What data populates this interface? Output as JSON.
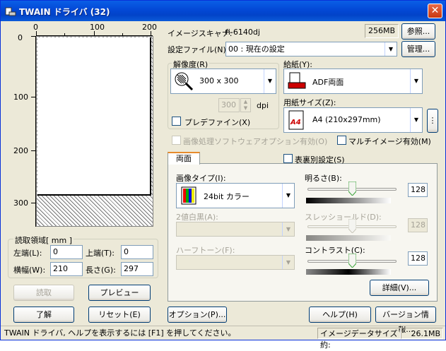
{
  "window": {
    "title": "TWAIN ドライバ (32)",
    "close": "✕"
  },
  "ruler": {
    "top_labels": [
      "0",
      "100",
      "200"
    ],
    "left_labels": [
      "0",
      "100",
      "200",
      "300"
    ]
  },
  "scanner": {
    "label": "イメージスキャナ:",
    "model": "fi-6140dj",
    "memory": "256MB",
    "browse": "参照..."
  },
  "settings_file": {
    "label": "設定ファイル(N):",
    "value": "00 : 現在の設定",
    "manage": "管理..."
  },
  "resolution": {
    "label": "解像度(R)",
    "value": "300 x 300",
    "custom_value": "300",
    "unit": "dpi",
    "prefine": "プレデファイン(X)"
  },
  "paper_source": {
    "label": "給紙(Y):",
    "value": "ADF両面"
  },
  "paper_size": {
    "label": "用紙サイズ(Z):",
    "value": "A4 (210x297mm)",
    "more": "⋮"
  },
  "image_option": "画像処理ソフトウェアオプション有効(O)",
  "multi_image": "マルチイメージ有効(M)",
  "tabs": {
    "active": "両面",
    "front_back": "表裏別設定(S)"
  },
  "image_type": {
    "label": "画像タイプ(I):",
    "value": "24bit カラー"
  },
  "binary": {
    "label": "2値白黒(A):",
    "value": ""
  },
  "halftone": {
    "label": "ハーフトーン(F):",
    "value": ""
  },
  "brightness": {
    "label": "明るさ(B):",
    "value": "128"
  },
  "threshold": {
    "label": "スレッショールド(D):",
    "value": "128"
  },
  "contrast": {
    "label": "コントラスト(C):",
    "value": "128"
  },
  "detail": "詳細(V)...",
  "scan_area": {
    "title": "読取領域[ mm ]",
    "left_label": "左端(L):",
    "left_value": "0",
    "top_label": "上端(T):",
    "top_value": "0",
    "width_label": "横幅(W):",
    "width_value": "210",
    "length_label": "長さ(G):",
    "length_value": "297"
  },
  "buttons": {
    "scan": "読取",
    "preview": "プレビュー",
    "ok": "了解",
    "reset": "リセット(E)",
    "options": "オプション(P)...",
    "help": "ヘルプ(H)",
    "version": "バージョン情報..."
  },
  "status": {
    "message": "TWAIN ドライバ, ヘルプを表示するには [F1] を押してください。",
    "size_label": "イメージデータサイズ 約:",
    "size_value": "26.1MB"
  },
  "colors": {
    "titlebar": "#0348d6",
    "face": "#ece9d8"
  }
}
